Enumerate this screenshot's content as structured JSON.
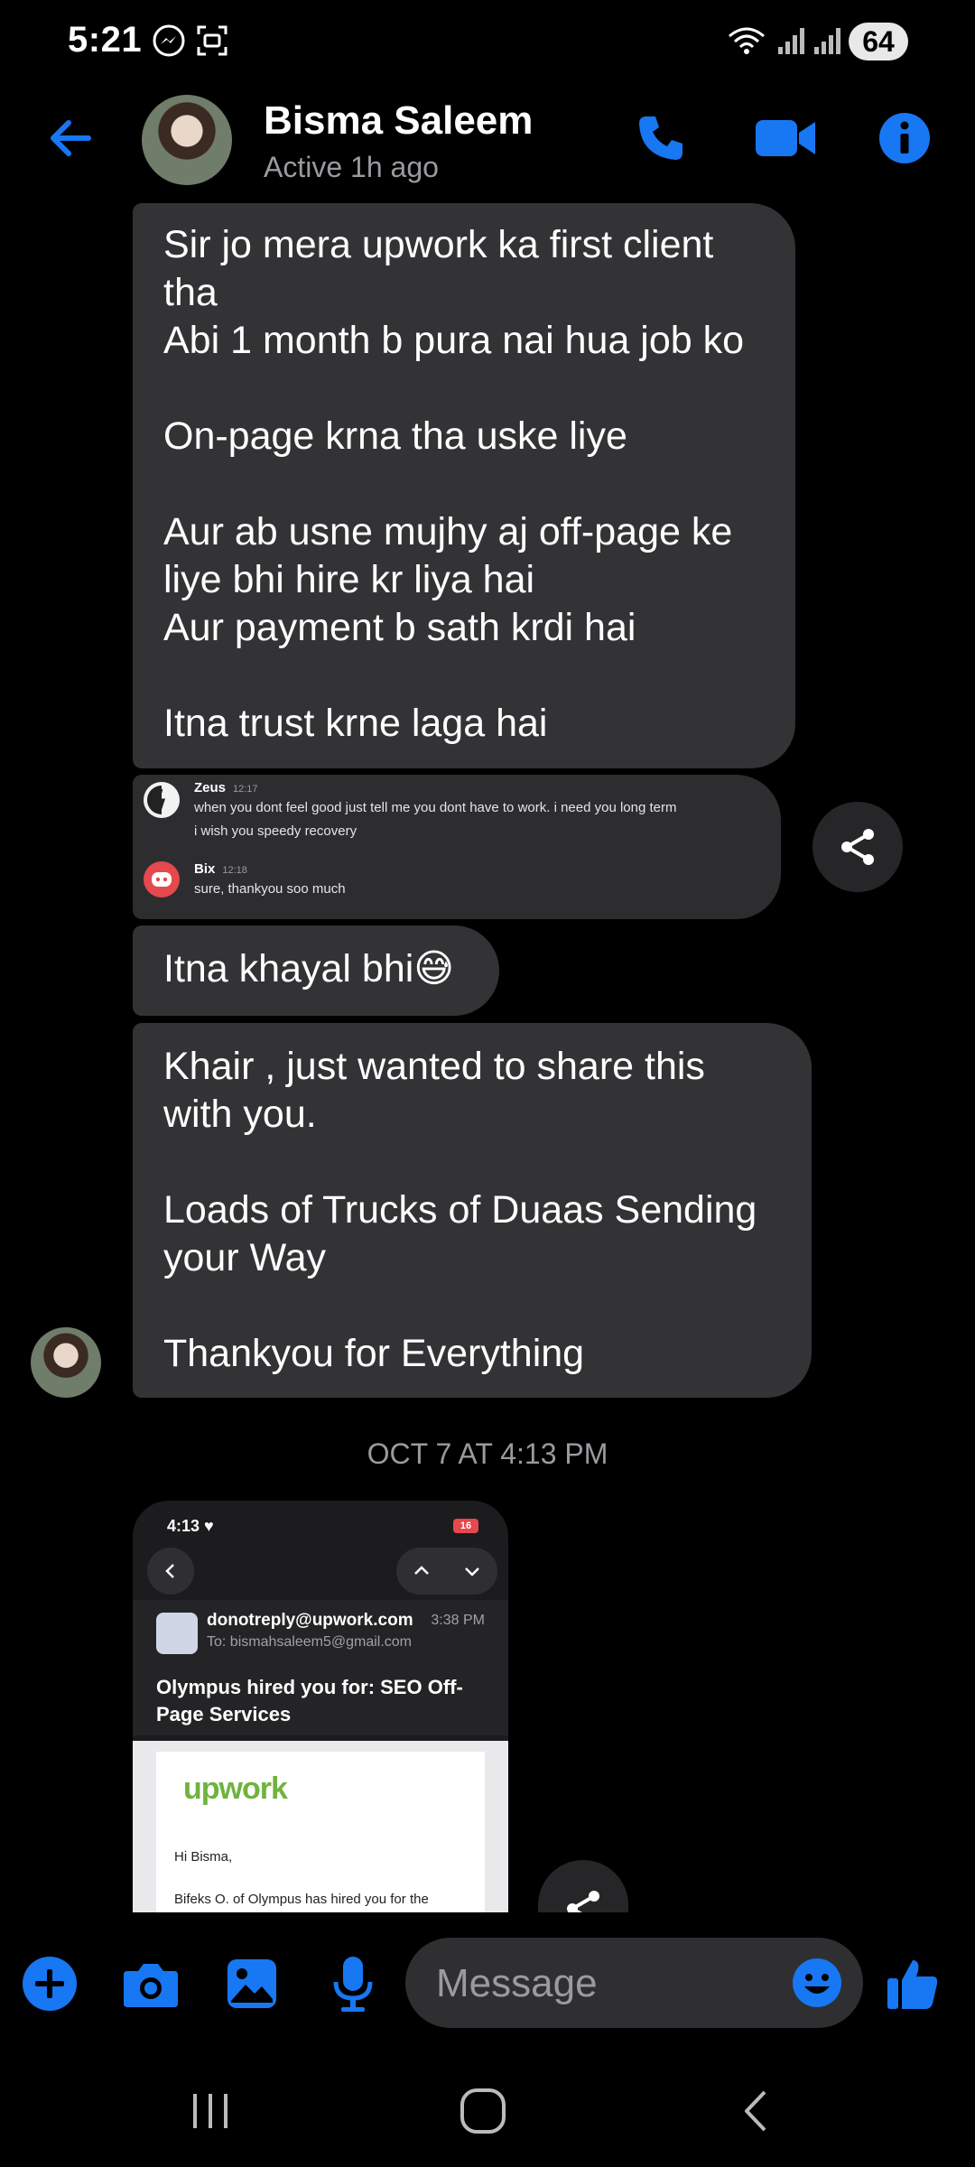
{
  "status_bar": {
    "time": "5:21",
    "battery": "64"
  },
  "header": {
    "name": "Bisma Saleem",
    "status": "Active 1h ago"
  },
  "messages": {
    "m1": "Sir jo mera upwork ka first client tha\nAbi 1 month b pura nai hua job ko\n\nOn-page krna tha uske liye\n\nAur ab usne mujhy aj off-page ke liye bhi hire kr liya hai\nAur payment b sath krdi hai\n\nItna trust krne laga hai",
    "m3": "Itna khayal bhi😅",
    "m4": "Khair , just wanted to share this with you.\n\nLoads of Trucks of Duaas Sending your Way\n\nThankyou for Everything"
  },
  "discord_image": {
    "msg1": {
      "name": "Zeus",
      "time": "12:17",
      "line1": "when you dont feel good just tell me you dont  have to work. i need you long term",
      "line2": "i wish you speedy recovery"
    },
    "msg2": {
      "name": "Bix",
      "time": "12:18",
      "line1": "sure, thankyou soo much"
    }
  },
  "date_separator": "OCT 7 AT 4:13 PM",
  "screenshot_image": {
    "time": "4:13",
    "battery": "16",
    "from": "donotreply@upwork.com",
    "time_sent": "3:38 PM",
    "to": "To: bismahsaleem5@gmail.com",
    "subject": "Olympus hired you for: SEO Off-Page Services",
    "logo": "upwork",
    "greeting": "Hi Bisma,",
    "body": "Bifeks O. of Olympus has hired you for the"
  },
  "composer": {
    "placeholder": "Message"
  },
  "colors": {
    "accent": "#1877f2",
    "bubble": "#333335",
    "background": "#000000"
  }
}
